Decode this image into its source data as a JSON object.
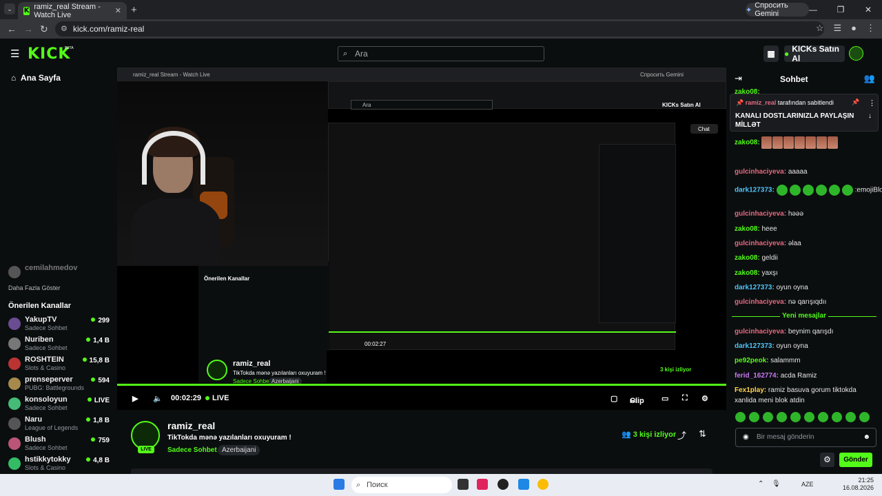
{
  "browser": {
    "tab_title": "ramiz_real Stream - Watch Live",
    "gemini_label": "Спросить Gemini",
    "url": "kick.com/ramiz-real"
  },
  "topnav": {
    "logo": "KICK",
    "beta": "BETA",
    "search_placeholder": "Ara",
    "kicks_button": "KICKs Satın Al"
  },
  "sidebar": {
    "home": "Ana Sayfa",
    "followed_partial": "cemilahmedov",
    "show_more": "Daha Fazla Göster",
    "recommended_title": "Önerilen Kanallar",
    "channels": [
      {
        "name": "YakupTV",
        "category": "Sadece Sohbet",
        "viewers": "299"
      },
      {
        "name": "Nuriben",
        "category": "Sadece Sohbet",
        "viewers": "1,4 B"
      },
      {
        "name": "ROSHTEIN",
        "category": "Slots & Casino",
        "viewers": "15,8 B"
      },
      {
        "name": "prenseperver",
        "category": "PUBG: Battlegrounds",
        "viewers": "594"
      },
      {
        "name": "konsoloyun",
        "category": "Sadece Sohbet",
        "viewers": "LIVE"
      },
      {
        "name": "Naru",
        "category": "League of Legends",
        "viewers": "1,8 B"
      },
      {
        "name": "Blush",
        "category": "Sadece Sohbet",
        "viewers": "759"
      },
      {
        "name": "hstikkytokky",
        "category": "Slots & Casino",
        "viewers": "4,8 B"
      }
    ]
  },
  "player": {
    "overlay_channel": "ramiz_real",
    "overlay_title": "TikTokda mənə yazılanları oxuyuram !",
    "overlay_category": "Sadece Sohbet",
    "overlay_language": "Azerbaijani",
    "overlay_viewers": "3 kişi izliyor",
    "time": "00:02:29",
    "live_label": "LIVE",
    "clip_label": "Clip",
    "nested_chat_button": "Chat",
    "nested_time": "00:02:27"
  },
  "stream": {
    "channel": "ramiz_real",
    "title": "TikTokda mənə yazılanları oxuyuram !",
    "category": "Sadece Sohbet",
    "language": "Azerbaijani",
    "viewers": "3 kişi izliyor",
    "live_badge": "LIVE"
  },
  "chat": {
    "header": "Sohbet",
    "pinned_user": "ramiz_real",
    "pinned_by": "tarafından sabitlendi",
    "pinned_message": "KANALI DOSTLARINIZLA PAYLAŞIN MİLLƏT",
    "partial_top_user": "zako08:",
    "new_messages": "Yeni mesajlar",
    "messages": [
      {
        "user": "zako08:",
        "color": "#53fc18",
        "text": ""
      },
      {
        "user": "gulcinhaciyeva:",
        "color": "#e36b82",
        "text": "aaaaa"
      },
      {
        "user": "dark127373:",
        "color": "#4fc3f7",
        "text": ":emojiBlowKis:"
      },
      {
        "user": "gulcinhaciyeva:",
        "color": "#e36b82",
        "text": "həəə"
      },
      {
        "user": "zako08:",
        "color": "#53fc18",
        "text": "heee"
      },
      {
        "user": "gulcinhaciyeva:",
        "color": "#e36b82",
        "text": "əlaa"
      },
      {
        "user": "zako08:",
        "color": "#53fc18",
        "text": "geldii"
      },
      {
        "user": "zako08:",
        "color": "#53fc18",
        "text": "yaxşı"
      },
      {
        "user": "dark127373:",
        "color": "#4fc3f7",
        "text": "oyun oyna"
      },
      {
        "user": "gulcinhaciyeva:",
        "color": "#e36b82",
        "text": "nə qarışıqdıı"
      },
      {
        "user": "gulcinhaciyeva:",
        "color": "#e36b82",
        "text": "beynim qarışdı"
      },
      {
        "user": "dark127373:",
        "color": "#4fc3f7",
        "text": "oyun oyna"
      },
      {
        "user": "pe92peok:",
        "color": "#53fc18",
        "text": "salammm"
      },
      {
        "user": "ferid_162774:",
        "color": "#c678f0",
        "text": "acda Ramiz"
      },
      {
        "user": "Fex1play:",
        "color": "#ffd54f",
        "text": "ramiz basuva gorum tiktokda"
      },
      {
        "user": "",
        "color": "#e6e6e6",
        "text": "xanlida meni blok atdin"
      }
    ],
    "input_placeholder": "Bir mesaj gönderin",
    "send_button": "Gönder"
  },
  "taskbar": {
    "search_placeholder": "Поиск",
    "lang": "AZE",
    "time": "21:25",
    "date": "16.08.2026"
  },
  "colors": {
    "accent": "#53fc18",
    "background": "#0b0e0f"
  }
}
